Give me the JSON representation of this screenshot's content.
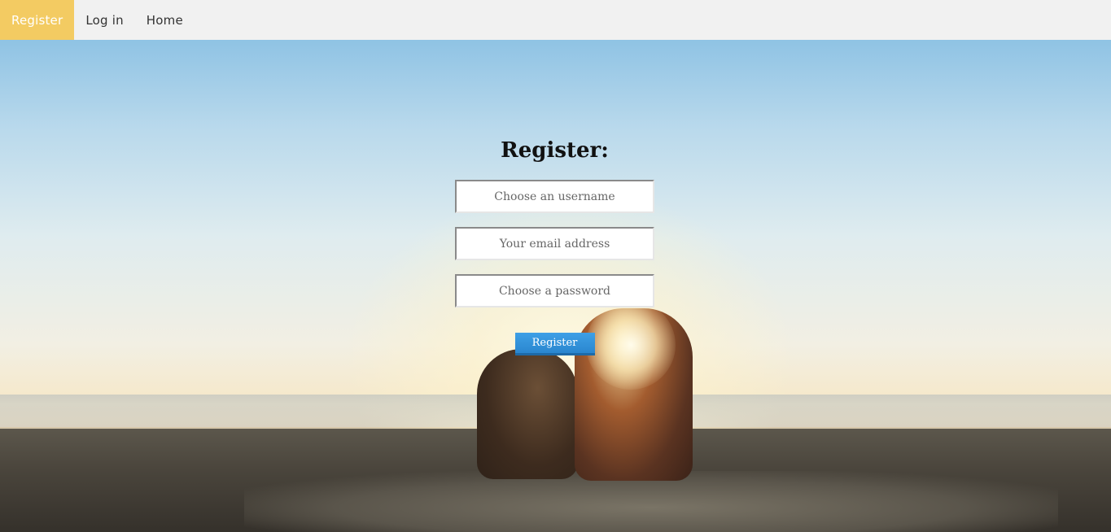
{
  "nav": {
    "items": [
      {
        "label": "Register",
        "active": true
      },
      {
        "label": "Log in",
        "active": false
      },
      {
        "label": "Home",
        "active": false
      }
    ]
  },
  "form": {
    "title": "Register:",
    "username_placeholder": "Choose an username",
    "email_placeholder": "Your email address",
    "password_placeholder": "Choose a password",
    "submit_label": "Register"
  },
  "colors": {
    "nav_active": "#f3cb62",
    "nav_bg": "#f1f1f1",
    "button": "#2a86cf"
  }
}
